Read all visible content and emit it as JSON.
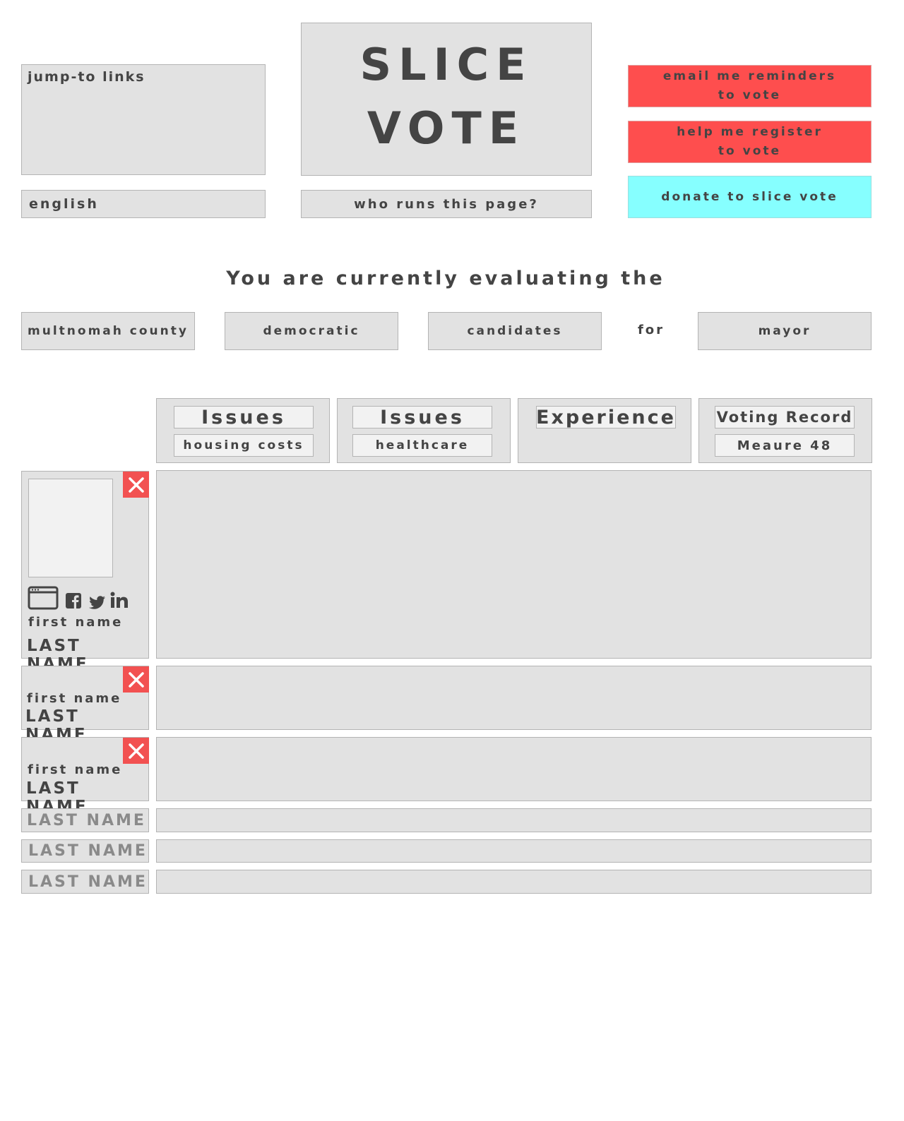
{
  "header": {
    "jump_links_label": "jump-to links",
    "language": "english",
    "logo_line1": "SLICE",
    "logo_line2": "VOTE",
    "who_runs": "who runs this page?",
    "email_reminder_line1": "email me reminders",
    "email_reminder_line2": "to vote",
    "register_line1": "help me register",
    "register_line2": "to vote",
    "donate": "donate to slice vote"
  },
  "evaluation": {
    "heading": "You are currently evaluating the",
    "county": "multnomah county",
    "party": "democratic",
    "type": "candidates",
    "connector": "for",
    "office": "mayor"
  },
  "columns": [
    {
      "title": "Issues",
      "subtitle": "housing costs"
    },
    {
      "title": "Issues",
      "subtitle": "healthcare"
    },
    {
      "title": "Experience",
      "subtitle": ""
    },
    {
      "title": "Voting Record",
      "subtitle": "Meaure 48"
    }
  ],
  "candidates": [
    {
      "first_name": "first name",
      "last_name": "LAST NAME"
    },
    {
      "first_name": "first name",
      "last_name": "LAST NAME"
    },
    {
      "first_name": "first name",
      "last_name": "LAST NAME"
    },
    {
      "last_name": "LAST NAME"
    },
    {
      "last_name": "LAST NAME"
    },
    {
      "last_name": "LAST NAME"
    }
  ],
  "icons": {
    "website": "browser-window-icon",
    "facebook": "facebook-icon",
    "twitter": "twitter-icon",
    "linkedin": "linkedin-icon",
    "remove": "close-icon"
  },
  "colors": {
    "action_red": "#fe4e4e",
    "donate_cyan": "#86ffff",
    "panel_gray": "#e2e2e2",
    "text_dark": "#444444"
  }
}
